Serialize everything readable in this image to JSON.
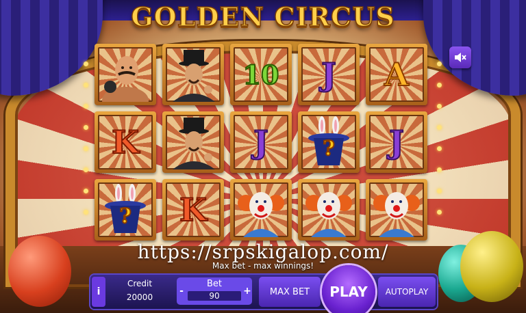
{
  "game": {
    "title": "GOLDEN CIRCUS"
  },
  "reels": {
    "rows": [
      [
        {
          "symbol": "strongman",
          "label": ""
        },
        {
          "symbol": "magician",
          "label": ""
        },
        {
          "symbol": "ten",
          "label": "10"
        },
        {
          "symbol": "jack",
          "label": "J"
        },
        {
          "symbol": "ace",
          "label": "A"
        }
      ],
      [
        {
          "symbol": "king",
          "label": "K"
        },
        {
          "symbol": "magician",
          "label": ""
        },
        {
          "symbol": "jack",
          "label": "J"
        },
        {
          "symbol": "mystery-hat",
          "label": "?"
        },
        {
          "symbol": "jack",
          "label": "J"
        }
      ],
      [
        {
          "symbol": "mystery-hat",
          "label": "?"
        },
        {
          "symbol": "king",
          "label": "K"
        },
        {
          "symbol": "clown",
          "label": ""
        },
        {
          "symbol": "clown",
          "label": ""
        },
        {
          "symbol": "clown",
          "label": ""
        }
      ]
    ]
  },
  "watermark": "https://srpskigalop.com/",
  "message": "Max bet - max winnings!",
  "controls": {
    "info_label": "i",
    "credit_label": "Credit",
    "credit_value": "20000",
    "bet_label": "Bet",
    "bet_value": "90",
    "bet_minus": "-",
    "bet_plus": "+",
    "max_bet_label": "MAX BET",
    "play_label": "PLAY",
    "autoplay_label": "AUTOPLAY"
  },
  "icons": {
    "sound": "sound-muted-icon"
  },
  "colors": {
    "panel": "#3a2a8a",
    "button": "#6a3ae0",
    "title_gold": "#ffcf4a"
  }
}
